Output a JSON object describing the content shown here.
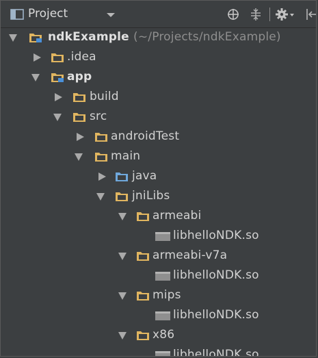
{
  "toolbar": {
    "title": "Project",
    "icons": [
      "project-icon",
      "chevron-down-icon",
      "target-icon",
      "collapse-all-icon",
      "gear-icon",
      "hide-icon"
    ]
  },
  "tree": {
    "root": {
      "label": "ndkExample",
      "path": "(~/Projects/ndkExample)"
    },
    "idea": ".idea",
    "app": "app",
    "build": "build",
    "src": "src",
    "android_test": "androidTest",
    "main": "main",
    "java": "java",
    "jni_libs": "jniLibs",
    "abis": [
      {
        "folder": "armeabi",
        "file": "libhelloNDK.so"
      },
      {
        "folder": "armeabi-v7a",
        "file": "libhelloNDK.so"
      },
      {
        "folder": "mips",
        "file": "libhelloNDK.so"
      },
      {
        "folder": "x86",
        "file": "libhelloNDK.so"
      }
    ]
  },
  "colors": {
    "background": "#3c3f41",
    "folder": "#e0b560",
    "source_folder": "#6fa8dc",
    "module_badge": "#4a90d9",
    "text": "#d2d2d2",
    "muted_text": "#8e8e8e"
  }
}
